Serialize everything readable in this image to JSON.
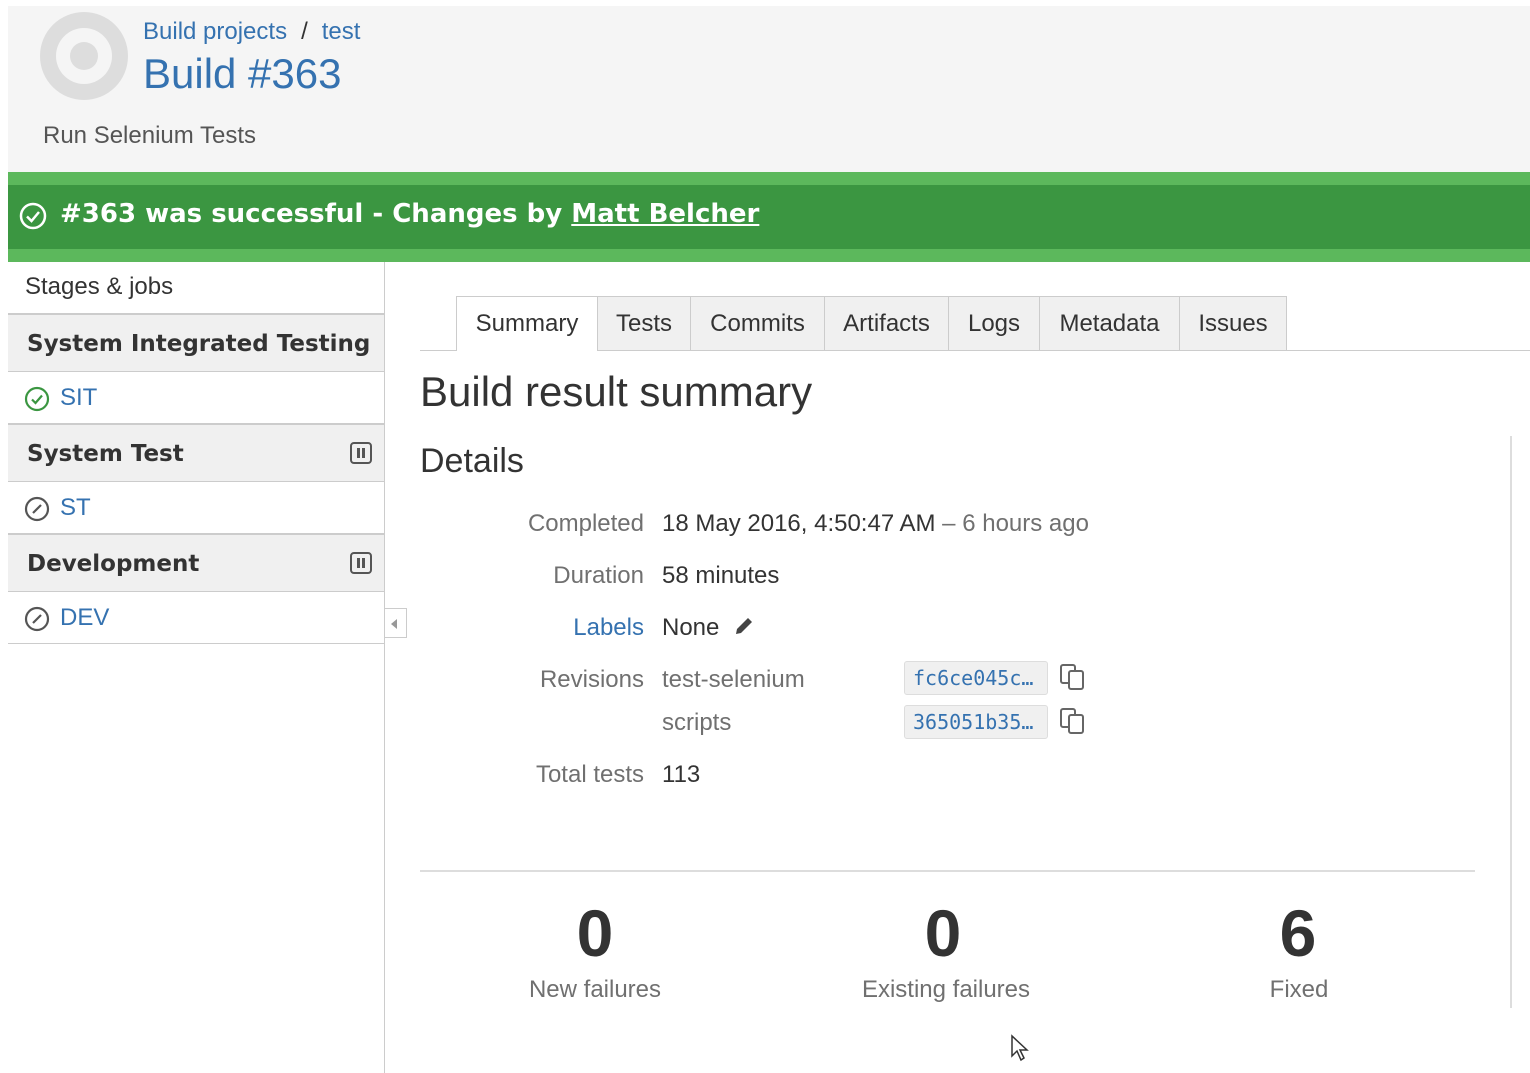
{
  "header": {
    "breadcrumb": [
      "Build projects",
      "test"
    ],
    "breadcrumb_separator": "/",
    "title": "Build #363",
    "plan_description": "Run Selenium Tests"
  },
  "banner": {
    "message": "#363 was successful - Changes by ",
    "author": "Matt Belcher",
    "color": "#3b9641"
  },
  "sidebar": {
    "heading": "Stages & jobs",
    "stages": [
      {
        "name": "System Integrated Testing",
        "manual": false,
        "jobs": [
          {
            "name": "SIT",
            "status": "success-icon"
          }
        ]
      },
      {
        "name": "System Test",
        "manual": true,
        "jobs": [
          {
            "name": "ST",
            "status": "not-run-icon"
          }
        ]
      },
      {
        "name": "Development",
        "manual": true,
        "jobs": [
          {
            "name": "DEV",
            "status": "not-run-icon"
          }
        ]
      }
    ]
  },
  "tabs": [
    "Summary",
    "Tests",
    "Commits",
    "Artifacts",
    "Logs",
    "Metadata",
    "Issues"
  ],
  "active_tab": "Summary",
  "main": {
    "title": "Build result summary",
    "details_title": "Details",
    "details": {
      "completed_label": "Completed",
      "completed_value": "18 May 2016, 4:50:47 AM",
      "completed_relative": " – 6 hours ago",
      "duration_label": "Duration",
      "duration_value": "58 minutes",
      "labels_label": "Labels",
      "labels_value": "None",
      "revisions_label": "Revisions",
      "revisions": [
        {
          "repo": "test-selenium",
          "hash": "fc6ce045c…"
        },
        {
          "repo": "scripts",
          "hash": "365051b35…"
        }
      ],
      "total_tests_label": "Total tests",
      "total_tests_value": "113"
    },
    "stats": [
      {
        "value": "0",
        "label": "New failures"
      },
      {
        "value": "0",
        "label": "Existing failures"
      },
      {
        "value": "6",
        "label": "Fixed"
      }
    ]
  }
}
